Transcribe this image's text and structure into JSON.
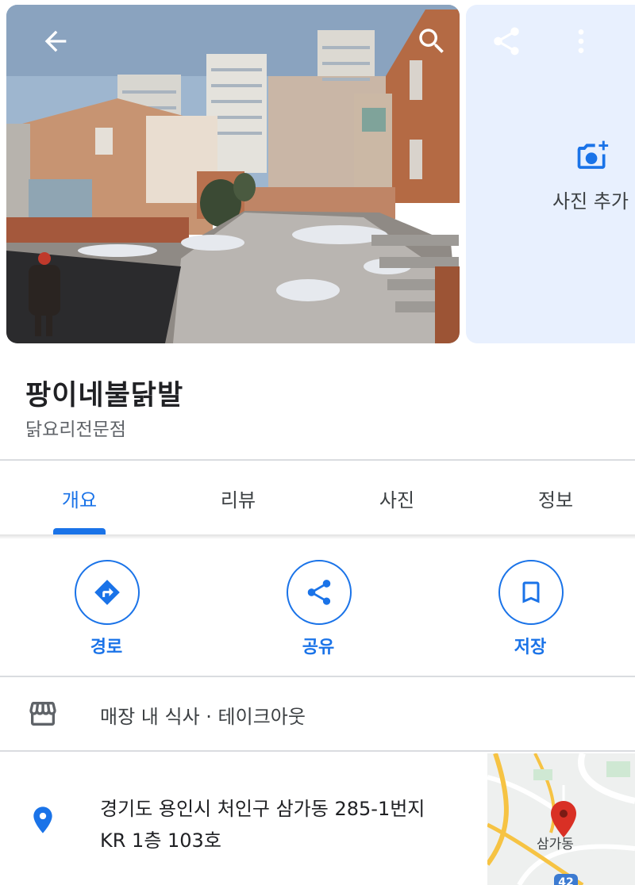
{
  "photos": {
    "add_photo_label": "사진 추가"
  },
  "place": {
    "name": "팡이네불닭발",
    "category": "닭요리전문점"
  },
  "tabs": [
    {
      "label": "개요",
      "active": true
    },
    {
      "label": "리뷰",
      "active": false
    },
    {
      "label": "사진",
      "active": false
    },
    {
      "label": "정보",
      "active": false
    }
  ],
  "actions": {
    "directions_label": "경로",
    "share_label": "공유",
    "save_label": "저장"
  },
  "service_options": "매장 내 식사 · 테이크아웃",
  "address": {
    "line1": "경기도 용인시 처인구 삼가동 285-1번지",
    "line2": "KR 1층 103호"
  },
  "minimap": {
    "area_label": "삼가동",
    "road_number": "42"
  },
  "colors": {
    "accent": "#1a73e8",
    "pin": "#d93025",
    "side_card": "#e8f0fe"
  },
  "icons": [
    "back-arrow-icon",
    "search-icon",
    "share-icon",
    "more-vert-icon",
    "add-photo-icon",
    "directions-icon",
    "bookmark-icon",
    "storefront-icon",
    "location-pin-icon"
  ]
}
